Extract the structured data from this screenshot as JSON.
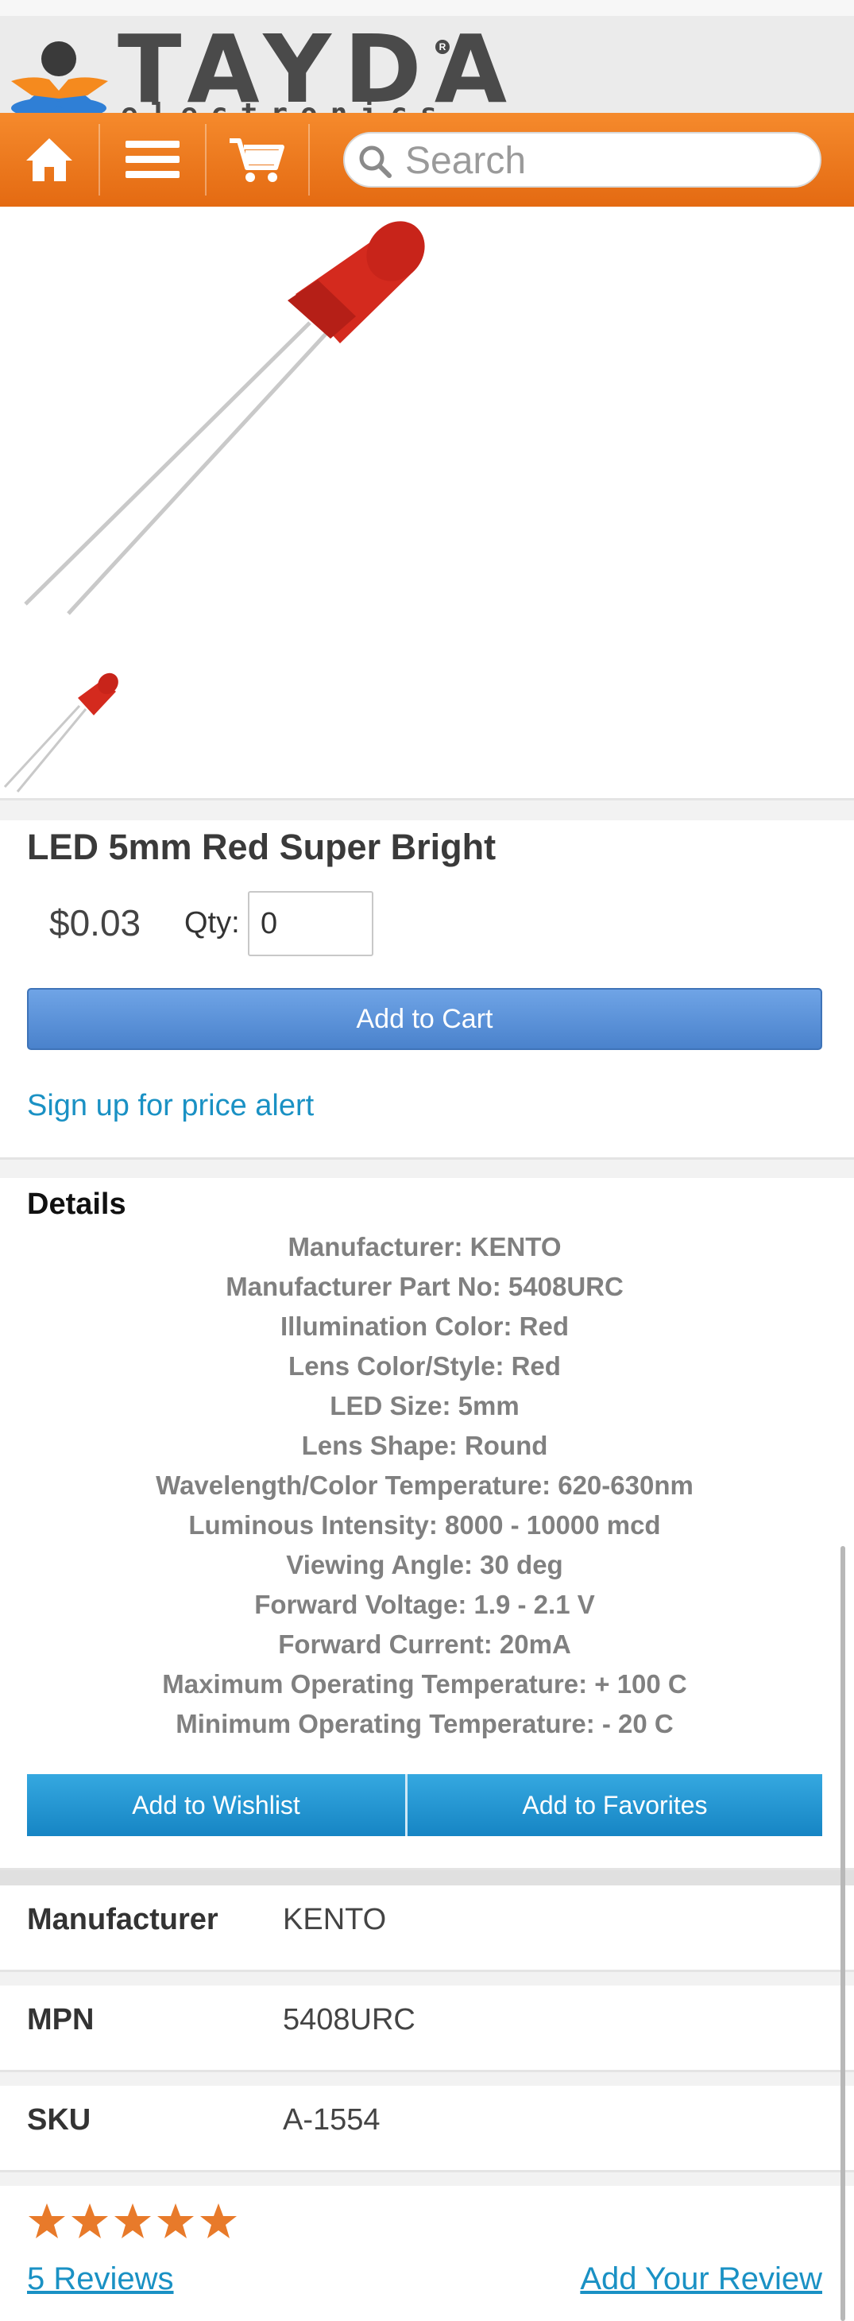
{
  "logo": {
    "word": "TAYDA",
    "sub": "electronics",
    "registered": "R"
  },
  "nav": {
    "search_placeholder": "Search"
  },
  "product": {
    "title": "LED 5mm Red Super Bright",
    "price": "$0.03",
    "qty_label": "Qty:",
    "qty_value": "0",
    "add_to_cart": "Add to Cart",
    "price_alert": "Sign up for price alert"
  },
  "details": {
    "title": "Details",
    "specs": [
      "Manufacturer: KENTO",
      "Manufacturer Part No: 5408URC",
      "Illumination Color: Red",
      "Lens Color/Style: Red",
      "LED Size: 5mm",
      "Lens Shape: Round",
      "Wavelength/Color Temperature: 620-630nm",
      "Luminous Intensity: 8000 - 10000 mcd",
      "Viewing Angle: 30 deg",
      "Forward Voltage: 1.9 - 2.1 V",
      "Forward Current: 20mA",
      "Maximum Operating Temperature: + 100 C",
      "Minimum Operating Temperature: - 20 C"
    ],
    "add_to_wishlist": "Add to Wishlist",
    "add_to_favorites": "Add to Favorites"
  },
  "attributes": [
    {
      "label": "Manufacturer",
      "value": "KENTO"
    },
    {
      "label": "MPN",
      "value": "5408URC"
    },
    {
      "label": "SKU",
      "value": "A-1554"
    }
  ],
  "reviews": {
    "rating": 5,
    "max_rating": 5,
    "count_label": "5 Reviews",
    "add_review": "Add Your Review"
  },
  "colors": {
    "nav_orange": "#ea7420",
    "link_blue": "#1a91c4",
    "cart_button_blue": "#5b93da",
    "wishlist_button_blue": "#1f95d1",
    "star_orange": "#e87a2a"
  }
}
